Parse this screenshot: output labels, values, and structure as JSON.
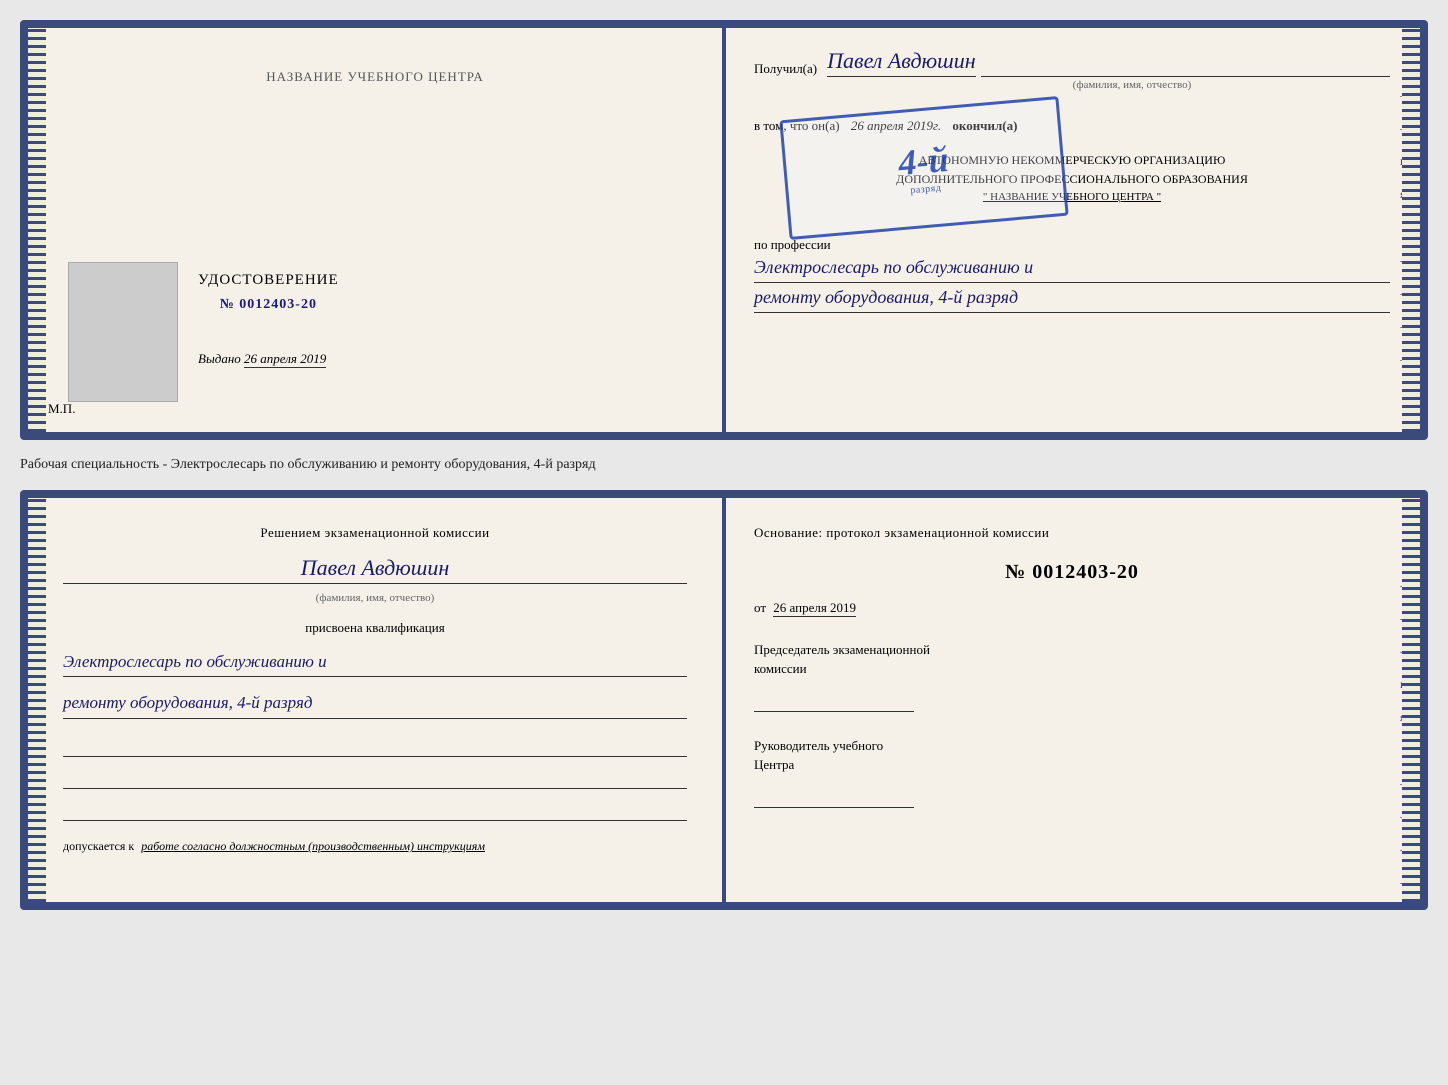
{
  "top_doc": {
    "left": {
      "training_center": "НАЗВАНИЕ УЧЕБНОГО ЦЕНТРА",
      "cert_title": "УДОСТОВЕРЕНИЕ",
      "cert_number_label": "№",
      "cert_number_value": "0012403-20",
      "issued_label": "Выдано",
      "issued_date": "26 апреля 2019",
      "mp_label": "М.П."
    },
    "right": {
      "received_label": "Получил(а)",
      "received_name": "Павел Авдюшин",
      "fio_label": "(фамилия, имя, отчество)",
      "in_that_label": "в том, что он(а)",
      "date_value": "26 апреля 2019г.",
      "finished_label": "окончил(а)",
      "org_line1": "АВТОНОМНУЮ НЕКОММЕРЧЕСКУЮ ОРГАНИЗАЦИЮ",
      "org_line2": "ДОПОЛНИТЕЛЬНОГО ПРОФЕССИОНАЛЬНОГО ОБРАЗОВАНИЯ",
      "org_name": "\" НАЗВАНИЕ УЧЕБНОГО ЦЕНТРА \"",
      "profession_label": "по профессии",
      "profession_value": "Электрослесарь по обслуживанию и",
      "profession_value2": "ремонту оборудования, 4-й разряд",
      "stamp_number": "4-й",
      "stamp_text": "разряд"
    }
  },
  "middle": {
    "text": "Рабочая специальность - Электрослесарь по обслуживанию и ремонту оборудования, 4-й разряд"
  },
  "bottom_doc": {
    "left": {
      "decision_line1": "Решением экзаменационной комиссии",
      "person_name": "Павел Авдюшин",
      "fio_label": "(фамилия, имя, отчество)",
      "qualification_label": "присвоена квалификация",
      "qualification_value": "Электрослесарь по обслуживанию и",
      "qualification_value2": "ремонту оборудования, 4-й разряд",
      "allowed_label": "допускается к",
      "allowed_value": "работе согласно должностным (производственным) инструкциям"
    },
    "right": {
      "basis_label": "Основание: протокол экзаменационной комиссии",
      "basis_number_label": "№",
      "basis_number": "0012403-20",
      "basis_date_label": "от",
      "basis_date": "26 апреля 2019",
      "chairman_line1": "Председатель экзаменационной",
      "chairman_line2": "комиссии",
      "director_line1": "Руководитель учебного",
      "director_line2": "Центра"
    }
  },
  "side_chars": [
    "–",
    "–",
    "и",
    "я",
    "←",
    "–",
    "–",
    "–",
    "–"
  ]
}
